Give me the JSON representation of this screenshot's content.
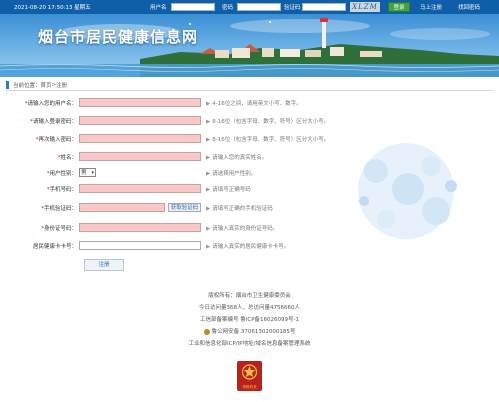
{
  "topbar": {
    "datetime": "2021-08-20 17:50:13 星期五",
    "username_label": "用户名",
    "password_label": "密码",
    "captcha_label": "验证码",
    "captcha_image_text": "XLZM",
    "login_button": "登录",
    "register_link": "马上注册",
    "forgot_link": "找回密码"
  },
  "banner": {
    "site_title": "烟台市居民健康信息网"
  },
  "breadcrumb": {
    "prefix": "当前位置：",
    "home": "首页",
    "separator": " > ",
    "current": "注册"
  },
  "form": {
    "fields": [
      {
        "label": "请输入您的用户名：",
        "required": true,
        "hint": "4-16位之间，请用英文小写、数字。"
      },
      {
        "label": "请输入登录密码：",
        "required": true,
        "hint": "8-16位（包含字母、数字、符号）区分大小写。"
      },
      {
        "label": "再次输入密码：",
        "required": true,
        "hint": "8-16位（包含字母、数字、符号）区分大小写。"
      },
      {
        "label": "姓名：",
        "required": true,
        "hint": "请输入您的真实姓名。"
      },
      {
        "label": "用户性别：",
        "required": true,
        "hint": "请选择用户性别。",
        "select_value": "男"
      },
      {
        "label": "手机号码：",
        "required": true,
        "hint": "请填写正确号码"
      },
      {
        "label": "手机验证码：",
        "required": true,
        "hint": "请填写正确的手机验证码",
        "button": "获取验证码"
      },
      {
        "label": "身份证号码：",
        "required": true,
        "hint": "请输入真实的身份证号码。"
      },
      {
        "label": "居民健康卡卡号：",
        "required": false,
        "hint": "请输入真实的居民健康卡卡号。"
      }
    ],
    "submit_label": "注册"
  },
  "footer": {
    "line1": "版权所有：烟台市卫生健康委员会",
    "line2": "今日访问量368人，总访问量4756660人",
    "line3": "工信部备案编号 鲁ICP备16026099号-1",
    "line4": "鲁公网安备 37061302000185号",
    "line5": "工业和信息化部ICP/IP地址/域名信息备案管理系统",
    "logo_text": "党政机关"
  },
  "colors": {
    "topbar": "#0f5ea8",
    "required_input": "#f9c9c9",
    "login_button": "#3fa340",
    "accent": "#2f7cc4"
  }
}
